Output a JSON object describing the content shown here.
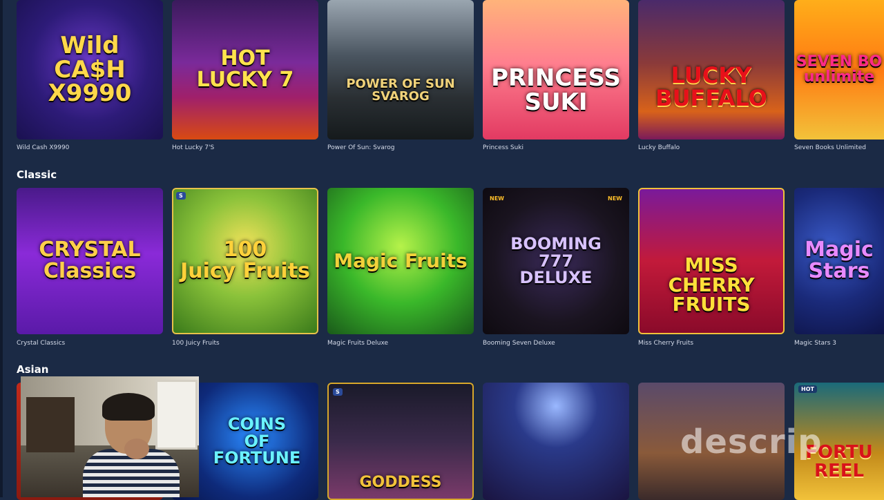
{
  "sections": {
    "top_row": {
      "tiles": [
        {
          "caption": "Wild Cash X9990",
          "logo": "Wild\nCA$H\nX9990"
        },
        {
          "caption": "Hot Lucky 7'S",
          "logo": "HOT\nLUCKY 7"
        },
        {
          "caption": "Power Of Sun: Svarog",
          "logo": "POWER OF SUN\nSVAROG"
        },
        {
          "caption": "Princess Suki",
          "logo": "PRINCESS\nSUKI"
        },
        {
          "caption": "Lucky Buffalo",
          "logo": "LUCKY\nBUFFALO"
        },
        {
          "caption": "Seven Books Unlimited",
          "logo": "SEVEN BO\nunlimite"
        }
      ]
    },
    "classic": {
      "title": "Classic",
      "tiles": [
        {
          "caption": "Crystal Classics",
          "logo": "CRYSTAL\nClassics"
        },
        {
          "caption": "100 Juicy Fruits",
          "logo": "100\nJuicy Fruits"
        },
        {
          "caption": "Magic Fruits Deluxe",
          "logo": "Magic Fruits"
        },
        {
          "caption": "Booming Seven Deluxe",
          "logo": "BOOMING\n777\nDELUXE"
        },
        {
          "caption": "Miss Cherry Fruits",
          "logo": "MISS\nCHERRY\nFRUITS"
        },
        {
          "caption": "Magic Stars 3",
          "logo": "Magic\nStars"
        }
      ]
    },
    "asian": {
      "title": "Asian",
      "tiles": [
        {
          "logo": ""
        },
        {
          "logo": "COINS\nOF\nFORTUNE"
        },
        {
          "logo": "GODDESS"
        },
        {
          "logo": ""
        },
        {
          "logo": ""
        },
        {
          "logo": "FORTU\nREEL"
        }
      ]
    }
  },
  "badges": {
    "new_left": "NEW",
    "new_right": "NEW",
    "hot": "HOT",
    "s_mark": "S"
  },
  "watermark": "descrip"
}
